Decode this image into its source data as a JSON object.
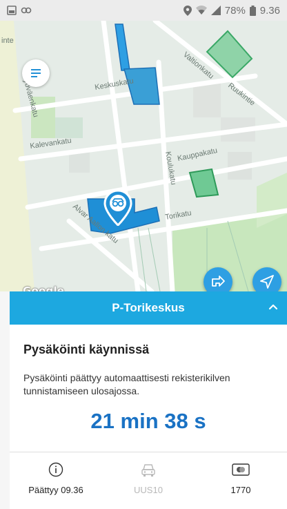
{
  "status_bar": {
    "battery_text": "78%",
    "time": "9.36",
    "left_icons": [
      "gallery-icon",
      "link-icon"
    ],
    "right_icons": [
      "location-icon",
      "wifi-icon",
      "signal-icon",
      "battery-icon"
    ]
  },
  "map": {
    "attribution": "Google",
    "streets": [
      "Keskuskatu",
      "Työväenkatu",
      "Valtionkatu",
      "Ruukintie",
      "Kalevankatu",
      "Kauppakatu",
      "Koulukatu",
      "Torikatu",
      "Alvar Aallon katu",
      "inte"
    ],
    "colors": {
      "parking_blue": "#1f8fd6",
      "green_zone": "#48b878",
      "park": "#c9e9bd",
      "fab": "#2e9fe3"
    }
  },
  "sheet": {
    "header_title": "P-Torikeskus",
    "parking_status": "Pysäköinti käynnissä",
    "description": "Pysäköinti päättyy automaattisesti rekisterikilven tunnistamiseen ulosajossa.",
    "timer": "21 min 38 s",
    "accent_color": "#1da8e0"
  },
  "footer": {
    "ended_label": "Päättyy 09.36",
    "vehicle_label": "UUS10",
    "card_label": "1770"
  }
}
